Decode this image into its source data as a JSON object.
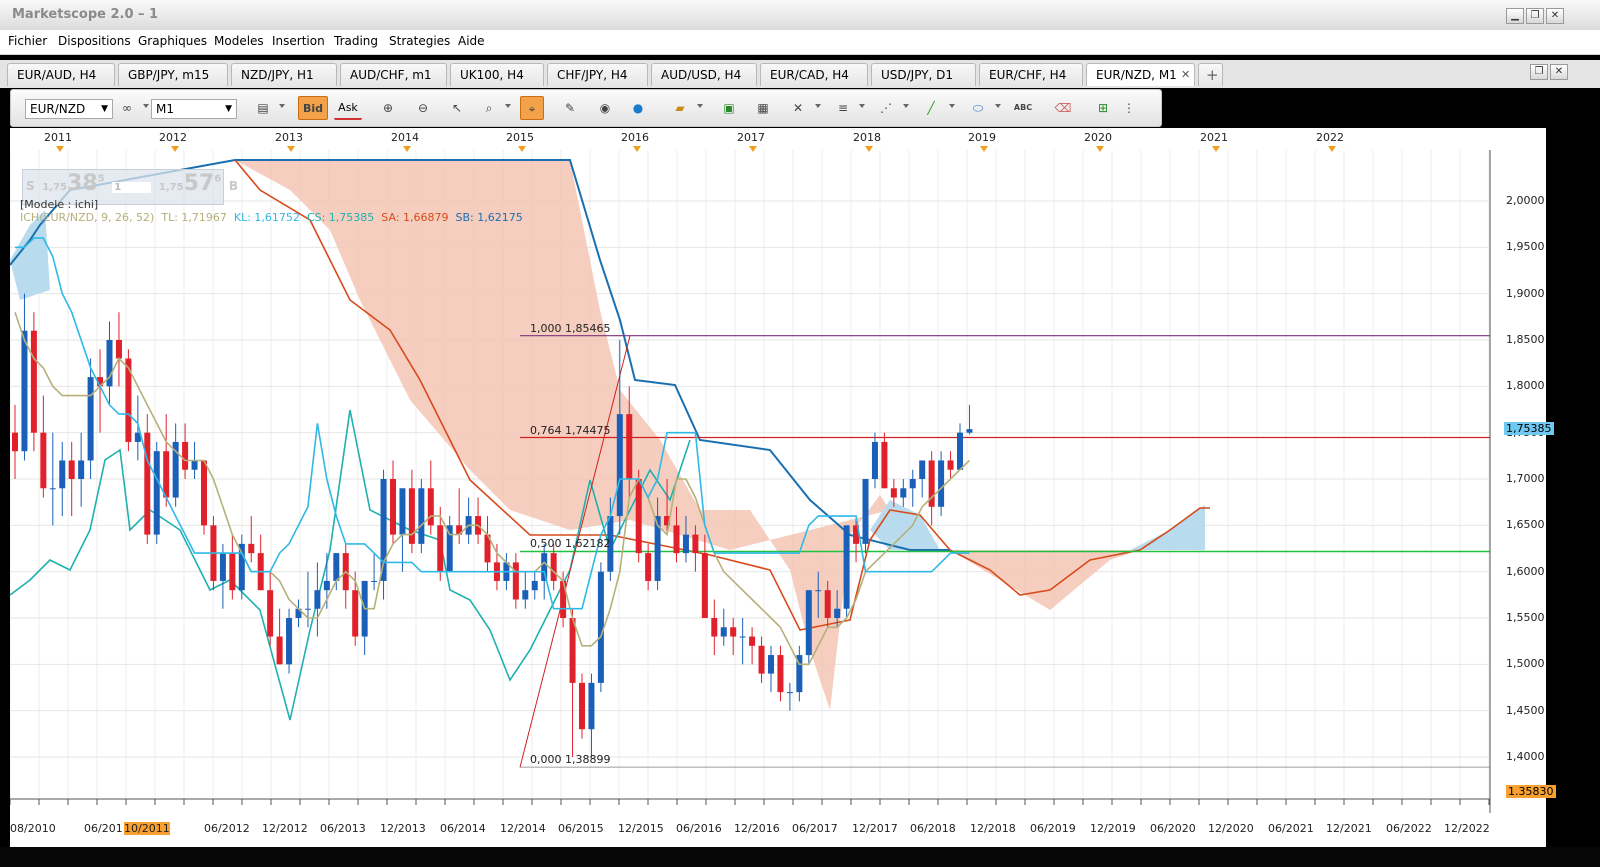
{
  "window": {
    "title": "Marketscope 2.0 – 1",
    "controls": [
      "minimize-icon",
      "restore-icon",
      "close-icon"
    ]
  },
  "menu": [
    "Fichier",
    "Dispositions",
    "Graphiques",
    "Modeles",
    "Insertion",
    "Trading",
    "Strategies",
    "Aide"
  ],
  "tabs": [
    {
      "label": "EUR/AUD, H4"
    },
    {
      "label": "GBP/JPY, m15"
    },
    {
      "label": "NZD/JPY, H1"
    },
    {
      "label": "AUD/CHF, m1"
    },
    {
      "label": "UK100, H4"
    },
    {
      "label": "CHF/JPY, H4"
    },
    {
      "label": "AUD/USD, H4"
    },
    {
      "label": "EUR/CAD, H4"
    },
    {
      "label": "USD/JPY, D1"
    },
    {
      "label": "EUR/CHF, H4"
    },
    {
      "label": "EUR/NZD, M1",
      "active": true
    }
  ],
  "tab_controls": {
    "close": "✕",
    "add": "+"
  },
  "toolbar": {
    "instrument": "EUR/NZD",
    "timeframe": "M1",
    "bid_label": "Bid",
    "ask_label": "Ask"
  },
  "years": [
    "2011",
    "2012",
    "2013",
    "2014",
    "2015",
    "2016",
    "2017",
    "2018",
    "2019",
    "2020",
    "2021",
    "2022"
  ],
  "info_box": {
    "s_label": "S",
    "sell_small": "1,75",
    "sell_big": "38",
    "sell_sup": "5",
    "spread": "1",
    "buy_small": "1,75",
    "buy_big": "57",
    "buy_sup": "6",
    "b_label": "B"
  },
  "model_label": "[Modele : ichi]",
  "legend": {
    "ich": "ICH(EUR/NZD, 9, 26, 52)",
    "tl": "TL: 1,71967",
    "kl": "KL: 1,61752",
    "cs": "CS: 1,75385",
    "sa": "SA: 1,66879",
    "sb": "SB: 1,62175"
  },
  "colors": {
    "tenkan": "#b5b07a",
    "kijun": "#2fb9e6",
    "chikou": "#20b0b0",
    "span_a": "#d84a1a",
    "span_b": "#1a6fb0",
    "bull_candle": "#1a5fb8",
    "bear_candle": "#e0202a",
    "bear_cloud": "#f5c6b4",
    "bull_cloud": "#b8dcee",
    "fib_top": "#803080",
    "fib_mid": "#d02020",
    "fib_50": "#20c040",
    "accent": "#f4a24a"
  },
  "price_axis": [
    "2,0000",
    "1,9500",
    "1,9000",
    "1,8500",
    "1,8000",
    "1,7500",
    "1,7000",
    "1,6500",
    "1,6000",
    "1,5500",
    "1,5000",
    "1,4500",
    "1,4000"
  ],
  "current_price": "1,75385",
  "low_price_badge": "1.35830",
  "fib_levels": [
    {
      "label": "1,000 1,85465",
      "price": 1.85465
    },
    {
      "label": "0,764 1,74475",
      "price": 1.74475
    },
    {
      "label": "0,500 1,62182",
      "price": 1.62182
    },
    {
      "label": "0,000 1,38899",
      "price": 1.38899
    }
  ],
  "time_axis": [
    "08/2010",
    "06/2011",
    "10/2011",
    "06/2012",
    "12/2012",
    "06/2013",
    "12/2013",
    "06/2014",
    "12/2014",
    "06/2015",
    "12/2015",
    "06/2016",
    "12/2016",
    "06/2017",
    "12/2017",
    "06/2018",
    "12/2018",
    "06/2019",
    "12/2019",
    "06/2020",
    "12/2020",
    "06/2021",
    "12/2021",
    "06/2022",
    "12/2022"
  ],
  "chart_data": {
    "type": "candlestick",
    "symbol": "EUR/NZD",
    "ylim": [
      1.358,
      2.04
    ],
    "candles": [
      {
        "o": 1.75,
        "h": 1.78,
        "l": 1.7,
        "c": 1.73
      },
      {
        "o": 1.73,
        "h": 1.9,
        "l": 1.72,
        "c": 1.86
      },
      {
        "o": 1.86,
        "h": 1.88,
        "l": 1.73,
        "c": 1.75
      },
      {
        "o": 1.75,
        "h": 1.79,
        "l": 1.68,
        "c": 1.69
      },
      {
        "o": 1.69,
        "h": 1.75,
        "l": 1.65,
        "c": 1.69
      },
      {
        "o": 1.69,
        "h": 1.74,
        "l": 1.66,
        "c": 1.72
      },
      {
        "o": 1.72,
        "h": 1.74,
        "l": 1.66,
        "c": 1.7
      },
      {
        "o": 1.7,
        "h": 1.75,
        "l": 1.67,
        "c": 1.72
      },
      {
        "o": 1.72,
        "h": 1.83,
        "l": 1.7,
        "c": 1.81
      },
      {
        "o": 1.81,
        "h": 1.84,
        "l": 1.75,
        "c": 1.8
      },
      {
        "o": 1.8,
        "h": 1.87,
        "l": 1.78,
        "c": 1.85
      },
      {
        "o": 1.85,
        "h": 1.88,
        "l": 1.8,
        "c": 1.83
      },
      {
        "o": 1.83,
        "h": 1.84,
        "l": 1.73,
        "c": 1.74
      },
      {
        "o": 1.74,
        "h": 1.79,
        "l": 1.72,
        "c": 1.75
      },
      {
        "o": 1.75,
        "h": 1.77,
        "l": 1.63,
        "c": 1.64
      },
      {
        "o": 1.64,
        "h": 1.74,
        "l": 1.63,
        "c": 1.73
      },
      {
        "o": 1.73,
        "h": 1.77,
        "l": 1.67,
        "c": 1.68
      },
      {
        "o": 1.68,
        "h": 1.76,
        "l": 1.67,
        "c": 1.74
      },
      {
        "o": 1.74,
        "h": 1.76,
        "l": 1.7,
        "c": 1.71
      },
      {
        "o": 1.71,
        "h": 1.74,
        "l": 1.7,
        "c": 1.72
      },
      {
        "o": 1.72,
        "h": 1.72,
        "l": 1.64,
        "c": 1.65
      },
      {
        "o": 1.65,
        "h": 1.66,
        "l": 1.58,
        "c": 1.59
      },
      {
        "o": 1.59,
        "h": 1.63,
        "l": 1.56,
        "c": 1.62
      },
      {
        "o": 1.62,
        "h": 1.64,
        "l": 1.57,
        "c": 1.58
      },
      {
        "o": 1.58,
        "h": 1.64,
        "l": 1.57,
        "c": 1.63
      },
      {
        "o": 1.63,
        "h": 1.66,
        "l": 1.61,
        "c": 1.62
      },
      {
        "o": 1.62,
        "h": 1.64,
        "l": 1.58,
        "c": 1.58
      },
      {
        "o": 1.58,
        "h": 1.6,
        "l": 1.52,
        "c": 1.53
      },
      {
        "o": 1.53,
        "h": 1.56,
        "l": 1.5,
        "c": 1.5
      },
      {
        "o": 1.5,
        "h": 1.56,
        "l": 1.49,
        "c": 1.55
      },
      {
        "o": 1.55,
        "h": 1.57,
        "l": 1.54,
        "c": 1.56
      },
      {
        "o": 1.56,
        "h": 1.6,
        "l": 1.54,
        "c": 1.56
      },
      {
        "o": 1.56,
        "h": 1.61,
        "l": 1.53,
        "c": 1.58
      },
      {
        "o": 1.58,
        "h": 1.62,
        "l": 1.56,
        "c": 1.59
      },
      {
        "o": 1.59,
        "h": 1.62,
        "l": 1.58,
        "c": 1.62
      },
      {
        "o": 1.62,
        "h": 1.63,
        "l": 1.56,
        "c": 1.58
      },
      {
        "o": 1.58,
        "h": 1.6,
        "l": 1.52,
        "c": 1.53
      },
      {
        "o": 1.53,
        "h": 1.59,
        "l": 1.51,
        "c": 1.59
      },
      {
        "o": 1.59,
        "h": 1.62,
        "l": 1.58,
        "c": 1.59
      },
      {
        "o": 1.59,
        "h": 1.71,
        "l": 1.57,
        "c": 1.7
      },
      {
        "o": 1.7,
        "h": 1.72,
        "l": 1.63,
        "c": 1.64
      },
      {
        "o": 1.64,
        "h": 1.69,
        "l": 1.6,
        "c": 1.69
      },
      {
        "o": 1.69,
        "h": 1.71,
        "l": 1.62,
        "c": 1.63
      },
      {
        "o": 1.63,
        "h": 1.7,
        "l": 1.62,
        "c": 1.69
      },
      {
        "o": 1.69,
        "h": 1.72,
        "l": 1.64,
        "c": 1.65
      },
      {
        "o": 1.65,
        "h": 1.67,
        "l": 1.59,
        "c": 1.6
      },
      {
        "o": 1.6,
        "h": 1.66,
        "l": 1.6,
        "c": 1.65
      },
      {
        "o": 1.65,
        "h": 1.69,
        "l": 1.63,
        "c": 1.64
      },
      {
        "o": 1.64,
        "h": 1.68,
        "l": 1.63,
        "c": 1.66
      },
      {
        "o": 1.66,
        "h": 1.68,
        "l": 1.63,
        "c": 1.64
      },
      {
        "o": 1.64,
        "h": 1.66,
        "l": 1.6,
        "c": 1.61
      },
      {
        "o": 1.61,
        "h": 1.63,
        "l": 1.58,
        "c": 1.59
      },
      {
        "o": 1.59,
        "h": 1.62,
        "l": 1.58,
        "c": 1.61
      },
      {
        "o": 1.61,
        "h": 1.62,
        "l": 1.56,
        "c": 1.57
      },
      {
        "o": 1.57,
        "h": 1.6,
        "l": 1.56,
        "c": 1.58
      },
      {
        "o": 1.58,
        "h": 1.6,
        "l": 1.57,
        "c": 1.59
      },
      {
        "o": 1.59,
        "h": 1.63,
        "l": 1.57,
        "c": 1.62
      },
      {
        "o": 1.62,
        "h": 1.63,
        "l": 1.58,
        "c": 1.59
      },
      {
        "o": 1.59,
        "h": 1.6,
        "l": 1.54,
        "c": 1.55
      },
      {
        "o": 1.55,
        "h": 1.56,
        "l": 1.4,
        "c": 1.48
      },
      {
        "o": 1.48,
        "h": 1.49,
        "l": 1.42,
        "c": 1.43
      },
      {
        "o": 1.43,
        "h": 1.49,
        "l": 1.4,
        "c": 1.48
      },
      {
        "o": 1.48,
        "h": 1.61,
        "l": 1.47,
        "c": 1.6
      },
      {
        "o": 1.6,
        "h": 1.68,
        "l": 1.59,
        "c": 1.66
      },
      {
        "o": 1.66,
        "h": 1.85,
        "l": 1.64,
        "c": 1.77
      },
      {
        "o": 1.77,
        "h": 1.8,
        "l": 1.68,
        "c": 1.7
      },
      {
        "o": 1.7,
        "h": 1.71,
        "l": 1.61,
        "c": 1.62
      },
      {
        "o": 1.62,
        "h": 1.63,
        "l": 1.58,
        "c": 1.59
      },
      {
        "o": 1.59,
        "h": 1.68,
        "l": 1.58,
        "c": 1.66
      },
      {
        "o": 1.66,
        "h": 1.7,
        "l": 1.64,
        "c": 1.65
      },
      {
        "o": 1.65,
        "h": 1.67,
        "l": 1.61,
        "c": 1.62
      },
      {
        "o": 1.62,
        "h": 1.66,
        "l": 1.61,
        "c": 1.64
      },
      {
        "o": 1.64,
        "h": 1.65,
        "l": 1.6,
        "c": 1.62
      },
      {
        "o": 1.62,
        "h": 1.64,
        "l": 1.55,
        "c": 1.55
      },
      {
        "o": 1.55,
        "h": 1.57,
        "l": 1.51,
        "c": 1.53
      },
      {
        "o": 1.53,
        "h": 1.56,
        "l": 1.52,
        "c": 1.54
      },
      {
        "o": 1.54,
        "h": 1.55,
        "l": 1.51,
        "c": 1.53
      },
      {
        "o": 1.53,
        "h": 1.55,
        "l": 1.5,
        "c": 1.53
      },
      {
        "o": 1.53,
        "h": 1.54,
        "l": 1.5,
        "c": 1.52
      },
      {
        "o": 1.52,
        "h": 1.53,
        "l": 1.48,
        "c": 1.49
      },
      {
        "o": 1.49,
        "h": 1.52,
        "l": 1.47,
        "c": 1.51
      },
      {
        "o": 1.51,
        "h": 1.52,
        "l": 1.46,
        "c": 1.47
      },
      {
        "o": 1.47,
        "h": 1.48,
        "l": 1.45,
        "c": 1.47
      },
      {
        "o": 1.47,
        "h": 1.52,
        "l": 1.46,
        "c": 1.51
      },
      {
        "o": 1.51,
        "h": 1.58,
        "l": 1.5,
        "c": 1.58
      },
      {
        "o": 1.58,
        "h": 1.6,
        "l": 1.55,
        "c": 1.58
      },
      {
        "o": 1.58,
        "h": 1.59,
        "l": 1.54,
        "c": 1.55
      },
      {
        "o": 1.55,
        "h": 1.58,
        "l": 1.54,
        "c": 1.56
      },
      {
        "o": 1.56,
        "h": 1.65,
        "l": 1.55,
        "c": 1.65
      },
      {
        "o": 1.65,
        "h": 1.66,
        "l": 1.61,
        "c": 1.63
      },
      {
        "o": 1.63,
        "h": 1.7,
        "l": 1.62,
        "c": 1.7
      },
      {
        "o": 1.7,
        "h": 1.75,
        "l": 1.69,
        "c": 1.74
      },
      {
        "o": 1.74,
        "h": 1.75,
        "l": 1.69,
        "c": 1.69
      },
      {
        "o": 1.69,
        "h": 1.7,
        "l": 1.67,
        "c": 1.68
      },
      {
        "o": 1.68,
        "h": 1.7,
        "l": 1.67,
        "c": 1.69
      },
      {
        "o": 1.69,
        "h": 1.71,
        "l": 1.67,
        "c": 1.7
      },
      {
        "o": 1.7,
        "h": 1.72,
        "l": 1.68,
        "c": 1.72
      },
      {
        "o": 1.72,
        "h": 1.73,
        "l": 1.65,
        "c": 1.67
      },
      {
        "o": 1.67,
        "h": 1.73,
        "l": 1.66,
        "c": 1.72
      },
      {
        "o": 1.72,
        "h": 1.73,
        "l": 1.7,
        "c": 1.71
      },
      {
        "o": 1.71,
        "h": 1.76,
        "l": 1.71,
        "c": 1.75
      },
      {
        "o": 1.75,
        "h": 1.78,
        "l": 1.748,
        "c": 1.7538
      }
    ],
    "series": [
      {
        "name": "TL",
        "values": [
          1.88,
          1.85,
          1.83,
          1.82,
          1.8,
          1.79,
          1.79,
          1.79,
          1.79,
          1.8,
          1.81,
          1.83,
          1.82,
          1.8,
          1.78,
          1.76,
          1.74,
          1.73,
          1.72,
          1.72,
          1.72,
          1.7,
          1.67,
          1.64,
          1.62,
          1.6,
          1.6,
          1.6,
          1.59,
          1.57,
          1.56,
          1.55,
          1.55,
          1.57,
          1.59,
          1.6,
          1.59,
          1.56,
          1.56,
          1.61,
          1.63,
          1.64,
          1.64,
          1.65,
          1.66,
          1.66,
          1.64,
          1.64,
          1.65,
          1.65,
          1.64,
          1.62,
          1.61,
          1.6,
          1.6,
          1.6,
          1.61,
          1.6,
          1.59,
          1.55,
          1.52,
          1.52,
          1.53,
          1.56,
          1.6,
          1.68,
          1.7,
          1.68,
          1.65,
          1.64,
          1.7,
          1.7,
          1.68,
          1.65,
          1.62,
          1.6,
          1.59,
          1.58,
          1.57,
          1.56,
          1.55,
          1.54,
          1.52,
          1.5,
          1.5,
          1.52,
          1.54,
          1.54,
          1.55,
          1.57,
          1.6,
          1.61,
          1.62,
          1.63,
          1.64,
          1.65,
          1.67,
          1.68,
          1.69,
          1.7,
          1.71,
          1.72
        ]
      },
      {
        "name": "KL",
        "values": [
          1.95,
          1.95,
          1.96,
          1.96,
          1.94,
          1.9,
          1.88,
          1.85,
          1.82,
          1.8,
          1.78,
          1.77,
          1.77,
          1.76,
          1.72,
          1.7,
          1.68,
          1.66,
          1.64,
          1.62,
          1.62,
          1.62,
          1.62,
          1.62,
          1.62,
          1.6,
          1.6,
          1.6,
          1.62,
          1.63,
          1.65,
          1.67,
          1.76,
          1.7,
          1.66,
          1.63,
          1.63,
          1.63,
          1.62,
          1.61,
          1.61,
          1.61,
          1.61,
          1.6,
          1.6,
          1.6,
          1.6,
          1.6,
          1.6,
          1.6,
          1.6,
          1.6,
          1.6,
          1.6,
          1.6,
          1.6,
          1.6,
          1.56,
          1.56,
          1.56,
          1.56,
          1.6,
          1.64,
          1.66,
          1.7,
          1.7,
          1.7,
          1.68,
          1.7,
          1.75,
          1.75,
          1.75,
          1.75,
          1.65,
          1.62,
          1.62,
          1.62,
          1.62,
          1.62,
          1.62,
          1.62,
          1.62,
          1.62,
          1.62,
          1.65,
          1.66,
          1.66,
          1.66,
          1.66,
          1.66,
          1.6,
          1.6,
          1.6,
          1.6,
          1.6,
          1.6,
          1.6,
          1.6,
          1.61,
          1.62,
          1.62,
          1.62
        ]
      }
    ]
  }
}
